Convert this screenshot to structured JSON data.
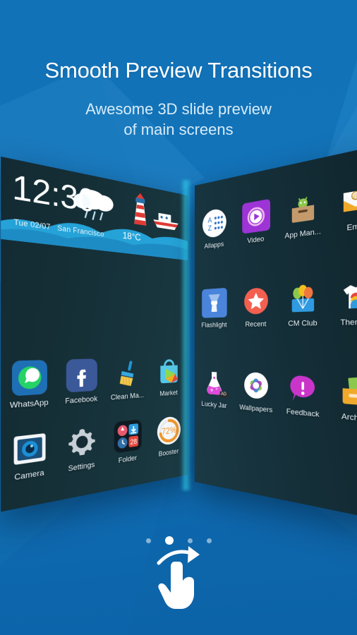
{
  "headline": "Smooth Preview Transitions",
  "subhead_line1": "Awesome 3D slide preview",
  "subhead_line2": "of main screens",
  "colors": {
    "background_top": "#1272b8",
    "background_bottom": "#0c63a8",
    "panel_dark": "#152b33",
    "edge_glow": "#2ec8eb",
    "accent_white": "#ffffff",
    "subhead_text": "#d8ecf8",
    "booster_ring": "#f0962a"
  },
  "clock_widget": {
    "time": "12:30",
    "date": "Tue 02/07",
    "city": "San Francisco",
    "temperature": "18°C",
    "icons": [
      "rain-cloud-icon",
      "lighthouse-icon",
      "boat-icon"
    ]
  },
  "left_panel": {
    "name": "home-screen-preview-left",
    "apps": [
      {
        "label": "WhatsApp",
        "icon": "whatsapp-icon"
      },
      {
        "label": "Facebook",
        "icon": "facebook-icon"
      },
      {
        "label": "Clean Ma...",
        "icon": "clean-master-broom-icon"
      },
      {
        "label": "Market",
        "icon": "play-store-bag-icon"
      },
      {
        "label": "Camera",
        "icon": "camera-icon"
      },
      {
        "label": "Settings",
        "icon": "gear-icon"
      },
      {
        "label": "Folder",
        "icon": "folder-icon"
      },
      {
        "label": "Booster",
        "icon": "booster-ring-icon",
        "value": "72%"
      }
    ]
  },
  "right_panel": {
    "name": "app-drawer-preview-right",
    "apps": [
      {
        "label": "Allapps",
        "icon": "allapps-az-grid-icon"
      },
      {
        "label": "Video",
        "icon": "video-play-icon"
      },
      {
        "label": "App Man...",
        "icon": "app-manager-box-icon"
      },
      {
        "label": "Ema",
        "icon": "email-envelope-icon"
      },
      {
        "label": "Flashlight",
        "icon": "flashlight-icon"
      },
      {
        "label": "Recent",
        "icon": "star-icon"
      },
      {
        "label": "CM Club",
        "icon": "balloons-icon"
      },
      {
        "label": "Themes",
        "icon": "tshirt-rainbow-icon"
      },
      {
        "label": "Lucky Jar",
        "icon": "flask-icon",
        "badge": "AD"
      },
      {
        "label": "Wallpapers",
        "icon": "wallpapers-flower-icon"
      },
      {
        "label": "Feedback",
        "icon": "feedback-bubble-icon"
      },
      {
        "label": "Archive",
        "icon": "archive-drawer-icon"
      }
    ]
  },
  "folder_contents": [
    "alarm-icon",
    "download-icon",
    "clock-icon",
    "calendar-28-icon"
  ],
  "pager": {
    "total_dots": 4,
    "active_index": 1,
    "gesture_icon": "swipe-right-hand-icon"
  }
}
